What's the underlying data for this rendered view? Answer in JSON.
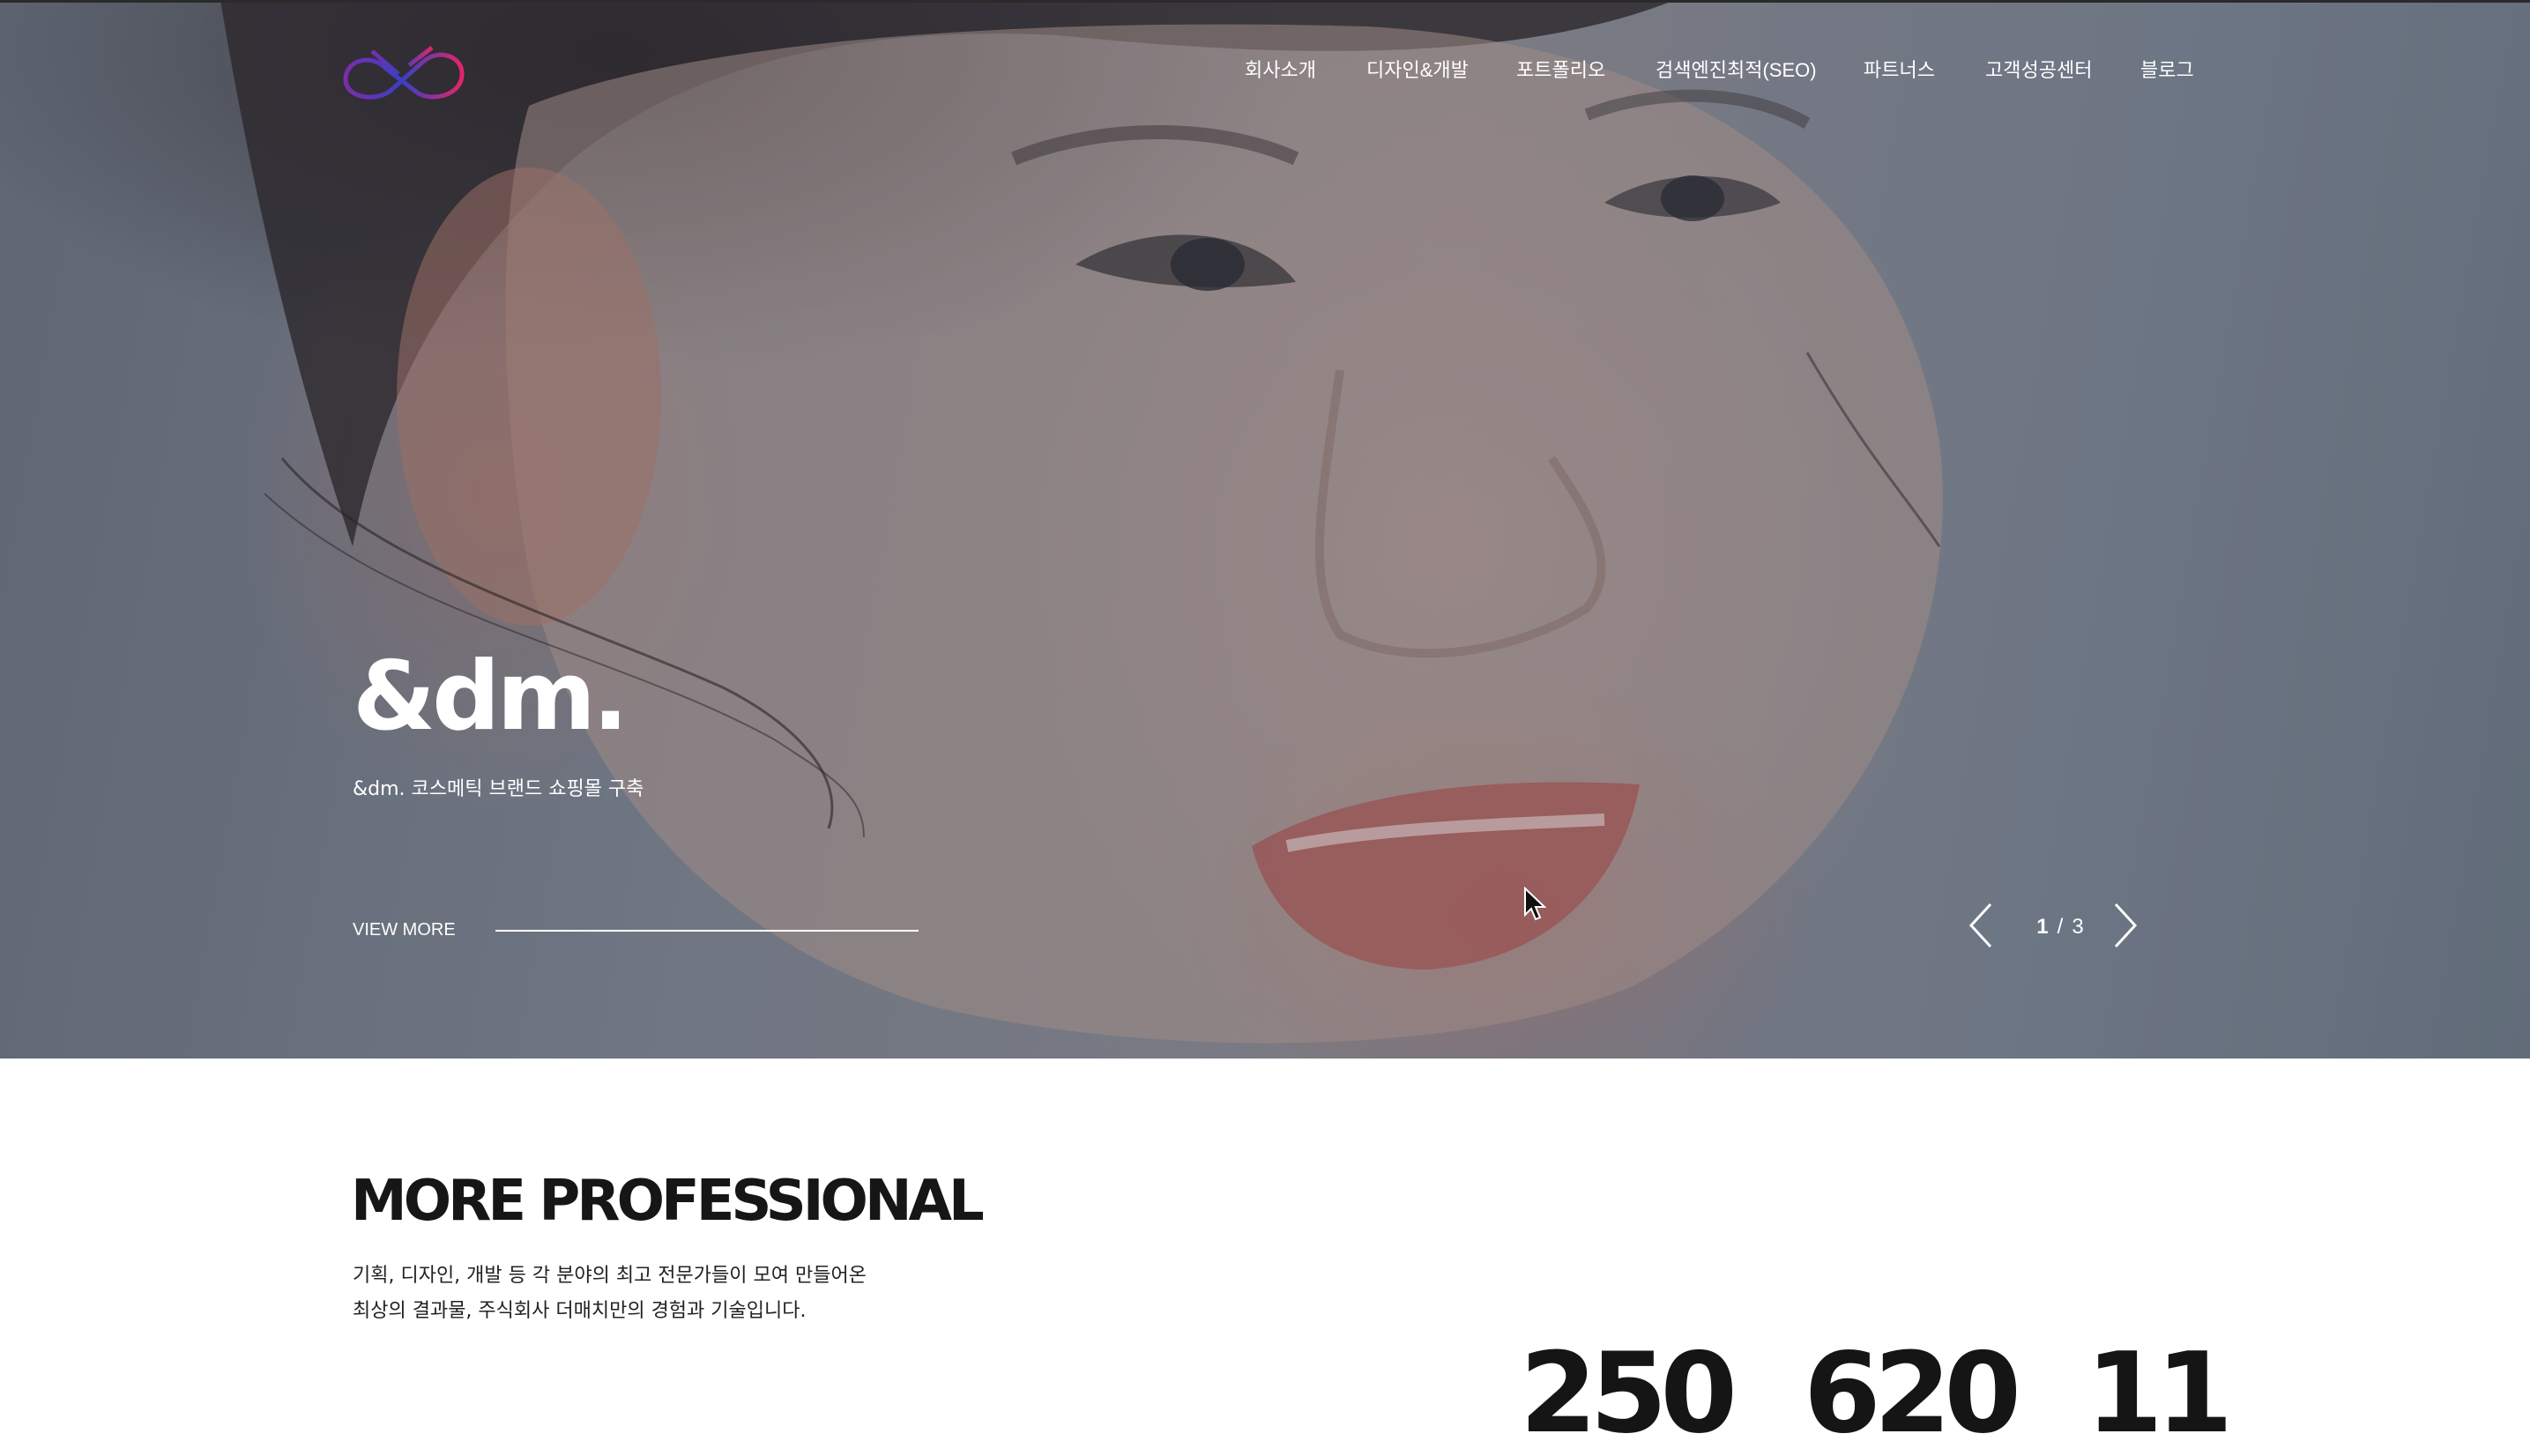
{
  "nav": {
    "items": [
      {
        "label": "회사소개"
      },
      {
        "label": "디자인&개발"
      },
      {
        "label": "포트폴리오"
      },
      {
        "label": "검색엔진최적(SEO)"
      },
      {
        "label": "파트너스"
      },
      {
        "label": "고객성공센터"
      },
      {
        "label": "블로그"
      }
    ]
  },
  "logo": {
    "icon": "infinity-logo-icon",
    "colors": [
      "#e2246c",
      "#7a2ea8",
      "#3b3fc4"
    ]
  },
  "hero": {
    "title": "&dm.",
    "subtitle": "&dm. 코스메틱 브랜드 쇼핑몰 구축",
    "cta_label": "VIEW MORE",
    "slider": {
      "current": "1",
      "separator": "/",
      "total": "3",
      "prev_icon": "chevron-left-icon",
      "next_icon": "chevron-right-icon"
    }
  },
  "section": {
    "title": "MORE PROFESSIONAL",
    "desc_line1": "기획, 디자인, 개발 등 각 분야의 최고 전문가들이 모여 만들어온",
    "desc_line2": "최상의 결과물, 주식회사 더매치만의 경험과 기술입니다."
  },
  "stats": [
    {
      "value": "250"
    },
    {
      "value": "620"
    },
    {
      "value": "11"
    }
  ],
  "colors": {
    "accent_pink": "#e2246c",
    "accent_purple": "#7a2ea8",
    "text_dark": "#161616"
  }
}
